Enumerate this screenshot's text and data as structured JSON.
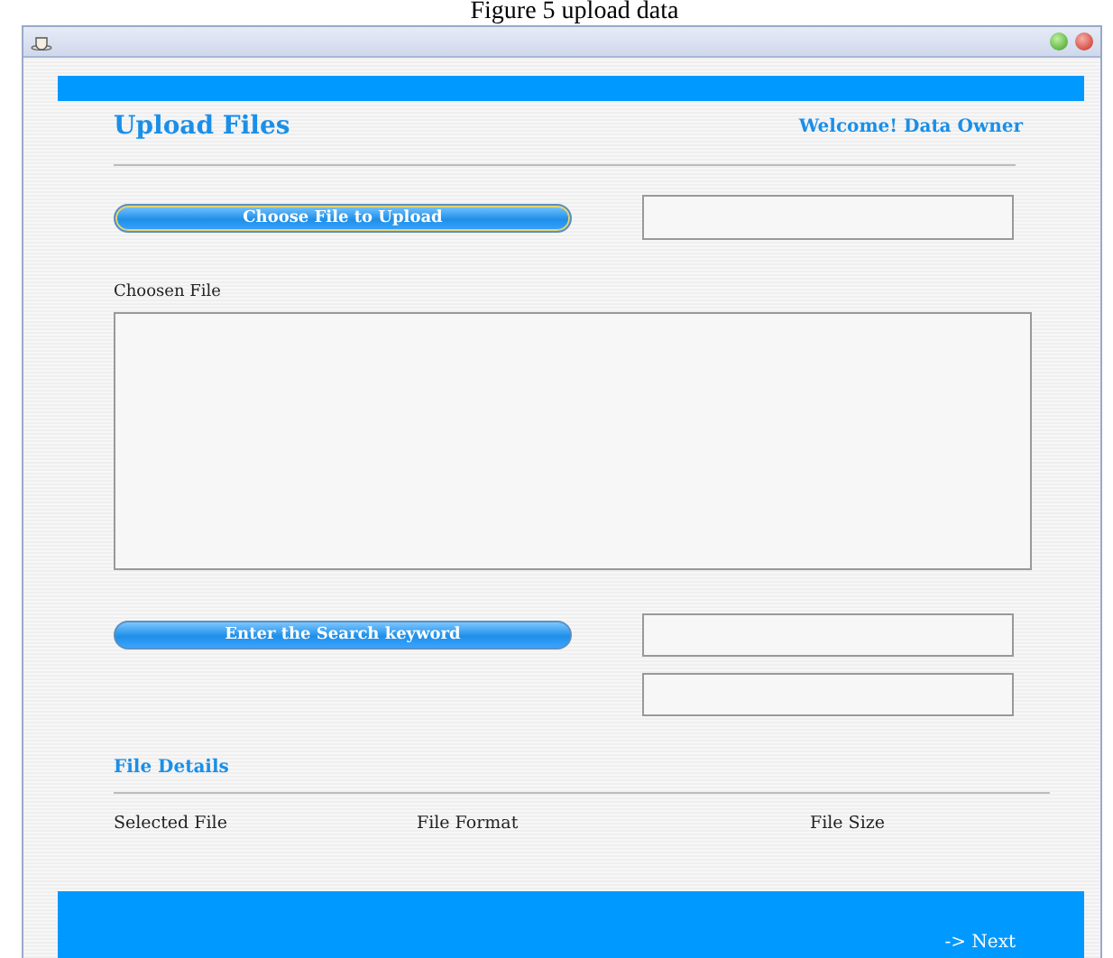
{
  "caption": "Figure 5 upload data",
  "header": {
    "title": "Upload Files",
    "welcome": "Welcome! Data Owner"
  },
  "choose_button": "Choose File to Upload",
  "chosen_file": {
    "label": "Choosen File"
  },
  "search_button": "Enter the Search keyword",
  "file_details": {
    "title": "File Details",
    "columns": [
      "Selected File",
      "File Format",
      "File Size"
    ]
  },
  "footer": {
    "next": "-> Next"
  }
}
